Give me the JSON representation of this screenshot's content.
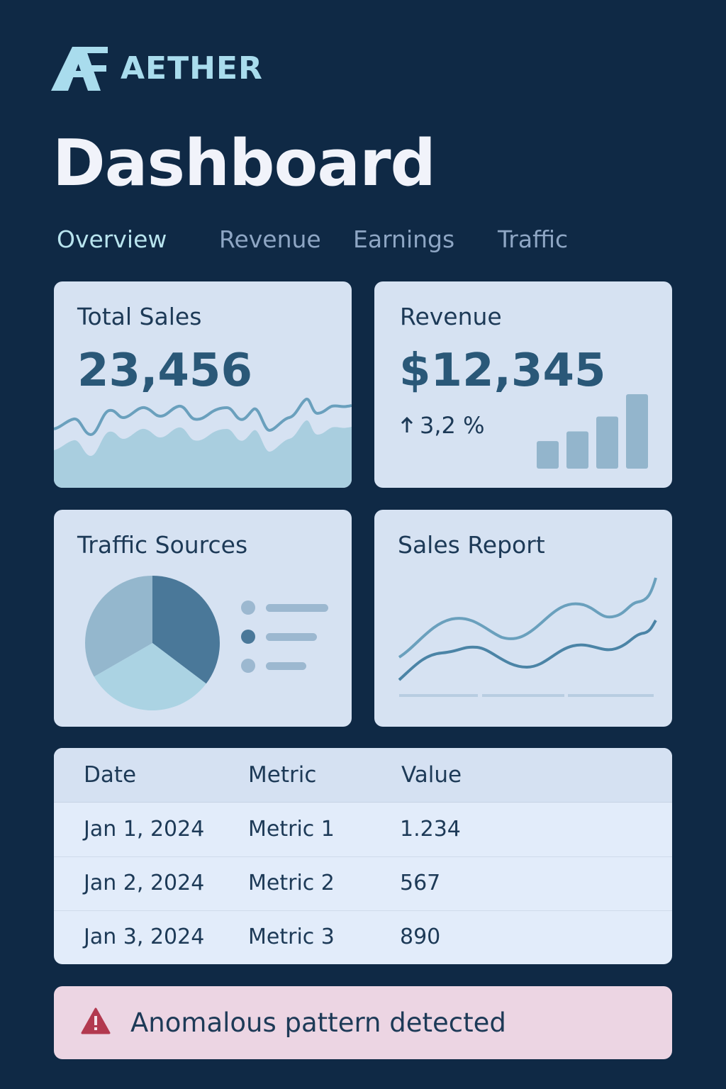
{
  "app": {
    "brand_name": "AETHER",
    "logo_mark": "AE",
    "brand_color": "#a9dced"
  },
  "page": {
    "title": "Dashboard"
  },
  "tabs": [
    {
      "label": "Overview",
      "active": true
    },
    {
      "label": "Revenue",
      "active": false
    },
    {
      "label": "Earnings",
      "active": false
    },
    {
      "label": "Traffic",
      "active": false
    }
  ],
  "cards": {
    "total_sales": {
      "title": "Total Sales",
      "value": "23,456",
      "sparkline_icon": "area-sparkline"
    },
    "revenue": {
      "title": "Revenue",
      "value": "$12,345",
      "change": "3,2 %",
      "change_icon": "arrow-up-icon",
      "bar_levels": [
        0.37,
        0.5,
        0.7,
        1.0
      ]
    },
    "traffic_sources": {
      "title": "Traffic Sources",
      "slices": [
        {
          "fraction": 0.353,
          "color": "#4a7899"
        },
        {
          "fraction": 0.314,
          "color": "#abd3e3"
        },
        {
          "fraction": 0.333,
          "color": "#94b7cd"
        }
      ],
      "legend_items": [
        {
          "dot_color": "#9cb8d0",
          "line_color": "#9cb8d0"
        },
        {
          "dot_color": "#4a7899",
          "line_color": "#9cb8d0"
        },
        {
          "dot_color": "#9cb8d0",
          "line_color": "#9cb8d0"
        }
      ]
    },
    "sales_report": {
      "title": "Sales Report",
      "series_colors": [
        "#6aa0bd",
        "#4b84a6"
      ]
    }
  },
  "table": {
    "columns": [
      "Date",
      "Metric",
      "Value"
    ],
    "rows": [
      [
        "Jan 1, 2024",
        "Metric 1",
        "1.234"
      ],
      [
        "Jan 2, 2024",
        "Metric 2",
        "567"
      ],
      [
        "Jan 3, 2024",
        "Metric 3",
        "890"
      ]
    ]
  },
  "alert": {
    "text": "Anomalous pattern detected",
    "icon": "warning-triangle-icon",
    "icon_color": "#b2394f"
  }
}
